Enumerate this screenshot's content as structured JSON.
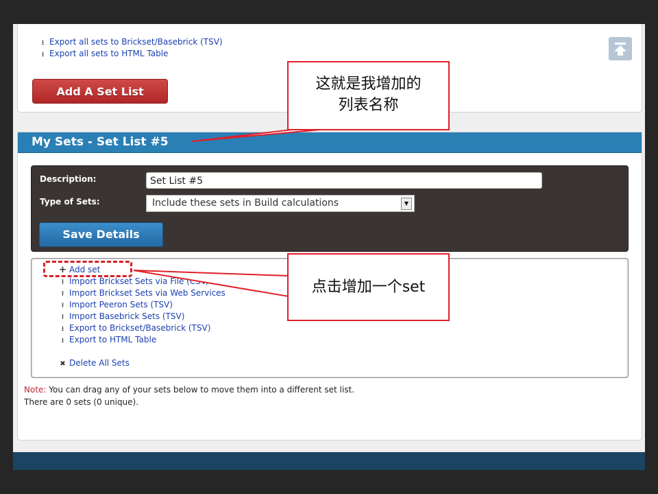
{
  "top_section": {
    "links": [
      {
        "icon": "download-icon",
        "label": "Export all sets to Brickset/Basebrick (TSV)"
      },
      {
        "icon": "download-icon",
        "label": "Export all sets to HTML Table"
      }
    ],
    "add_list_button": "Add A Set List"
  },
  "panel": {
    "title": "My Sets - Set List #5",
    "description_label": "Description:",
    "description_value": "Set List #5",
    "type_label": "Type of Sets:",
    "type_value": "Include these sets in Build calculations",
    "save_button": "Save Details",
    "actions": [
      {
        "icon": "plus-icon",
        "label": "Add set"
      },
      {
        "icon": "upload-icon",
        "label": "Import Brickset Sets via File (CSV/TXT)"
      },
      {
        "icon": "upload-icon",
        "label": "Import Brickset Sets via Web Services"
      },
      {
        "icon": "upload-icon",
        "label": "Import Peeron Sets (TSV)"
      },
      {
        "icon": "upload-icon",
        "label": "Import Basebrick Sets (TSV)"
      },
      {
        "icon": "download-icon",
        "label": "Export to Brickset/Basebrick (TSV)"
      },
      {
        "icon": "download-icon",
        "label": "Export to HTML Table"
      }
    ],
    "delete_all": {
      "icon": "close-icon",
      "label": "Delete All Sets"
    },
    "note_prefix": "Note:",
    "note_text": " You can drag any of your sets below to move them into a different set list.",
    "count_text": "There are 0 sets (0 unique)."
  },
  "annotations": {
    "callout_list_name_line1": "这就是我增加的",
    "callout_list_name_line2": "列表名称",
    "callout_add_set": "点击增加一个set"
  },
  "colors": {
    "header_blue": "#2a7fb5",
    "callout_red": "#e0202a",
    "link_blue": "#1a3fb0",
    "footer": "#1a4461"
  }
}
